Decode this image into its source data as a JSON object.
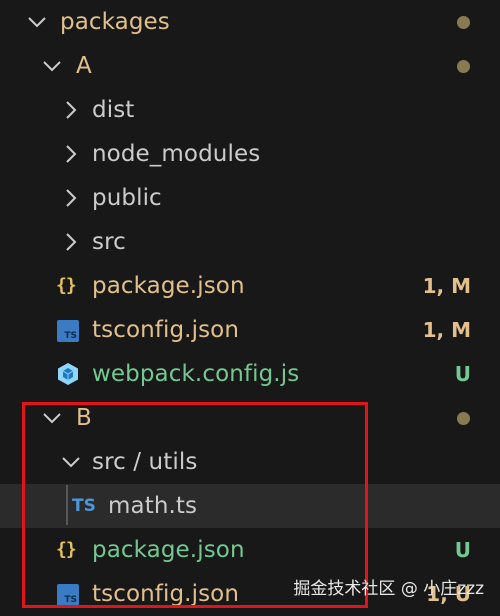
{
  "explorer": {
    "rows": [
      {
        "label": "packages",
        "status": "modified-dot"
      },
      {
        "label": "A",
        "status": "modified-dot"
      },
      {
        "label": "dist"
      },
      {
        "label": "node_modules"
      },
      {
        "label": "public"
      },
      {
        "label": "src"
      },
      {
        "label": "package.json",
        "badge": "1, M",
        "icon": "json-braces-icon"
      },
      {
        "label": "tsconfig.json",
        "badge": "1, M",
        "icon": "typescript-config-icon"
      },
      {
        "label": "webpack.config.js",
        "badge": "U",
        "icon": "webpack-cube-icon"
      },
      {
        "label": "B",
        "status": "modified-dot"
      },
      {
        "label": "src / utils"
      },
      {
        "label": "math.ts",
        "icon": "typescript-icon",
        "icon_text": "TS"
      },
      {
        "label": "package.json",
        "badge": "U",
        "icon": "json-braces-icon"
      },
      {
        "label": "tsconfig.json",
        "badge": "1, U",
        "icon": "typescript-config-icon"
      }
    ],
    "json_icon_text": "{}"
  },
  "highlight_color": "#e0141b",
  "colors": {
    "background": "#181818",
    "modified": "#e2c08d",
    "untracked": "#73c991",
    "folder": "#cccccc",
    "modified_badge": "#e2c08d"
  },
  "watermark": "掘金技术社区 @ 小庄zzz"
}
